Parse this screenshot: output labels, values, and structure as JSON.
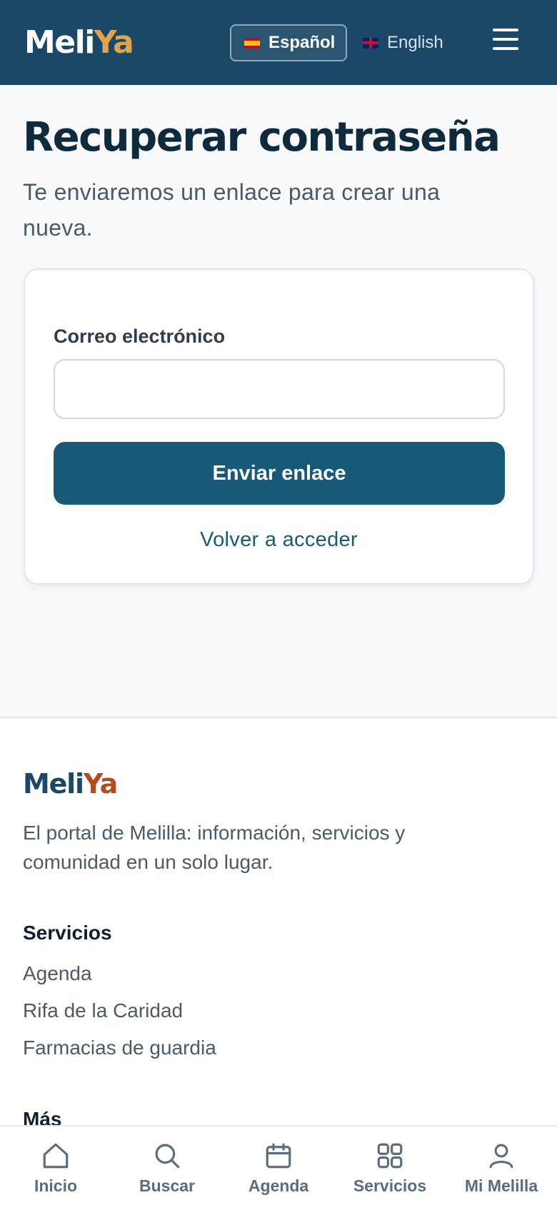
{
  "header": {
    "logo_part1": "Meli",
    "logo_part2": "Ya",
    "lang_es_label": "Español",
    "lang_en_label": "English",
    "menu_icon": "hamburger-menu-icon"
  },
  "main": {
    "title": "Recuperar contraseña",
    "subtitle": "Te enviaremos un enlace para crear una nueva.",
    "email_label": "Correo electrónico",
    "email_value": "",
    "email_placeholder": "",
    "submit_label": "Enviar enlace",
    "back_link": "Volver a acceder"
  },
  "footer": {
    "logo_part1": "Meli",
    "logo_part2": "Ya",
    "description": "El portal de Melilla: información, servicios y comunidad en un solo lugar.",
    "sections": [
      {
        "heading": "Servicios",
        "links": [
          "Agenda",
          "Rifa de la Caridad",
          "Farmacias de guardia"
        ]
      },
      {
        "heading": "Más"
      }
    ]
  },
  "bottom_nav": [
    {
      "label": "Inicio",
      "icon": "home-icon"
    },
    {
      "label": "Buscar",
      "icon": "search-icon"
    },
    {
      "label": "Agenda",
      "icon": "calendar-icon"
    },
    {
      "label": "Servicios",
      "icon": "grid-icon"
    },
    {
      "label": "Mi Melilla",
      "icon": "user-icon"
    }
  ],
  "colors": {
    "header_bg": "#1a4866",
    "logo_accent": "#e0a44a",
    "footer_logo_accent": "#b44a1e",
    "primary_button": "#175977",
    "link": "#1b5a78"
  }
}
